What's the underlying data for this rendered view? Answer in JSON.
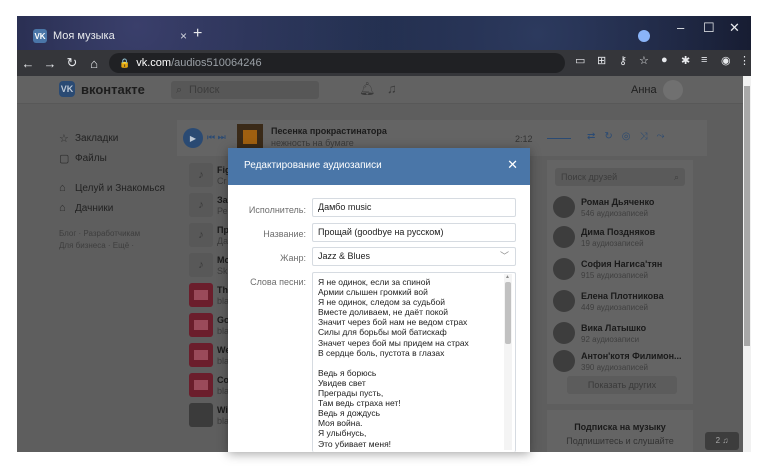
{
  "browser": {
    "tab_title": "Моя музыка",
    "tab_favicon": "VK",
    "close_tab": "×",
    "new_tab": "+",
    "url_host": "vk.com",
    "url_path": "/audios510064246"
  },
  "vk": {
    "logo_text": "вконтакте",
    "search_placeholder": "Поиск",
    "user_name": "Анна"
  },
  "menu": {
    "items": [
      {
        "label": "Закладки"
      },
      {
        "label": "Файлы"
      },
      {
        "label": "Целуй и Знакомься"
      },
      {
        "label": "Дачники"
      }
    ],
    "footer_line1": "Блог · Разработчикам",
    "footer_line2": "Для бизнеса · Ещё ·"
  },
  "player": {
    "track_title": "Песенка прокрастинатора",
    "track_artist": "нежность на бумаге",
    "time": "2:12"
  },
  "tracks": [
    {
      "title": "Fig",
      "artist": "Cr"
    },
    {
      "title": "За",
      "artist": "Ре"
    },
    {
      "title": "Пр",
      "artist": "Да"
    },
    {
      "title": "Мо",
      "artist": "Sk"
    },
    {
      "title": "Th",
      "artist": "bla"
    },
    {
      "title": "Go",
      "artist": "bla"
    },
    {
      "title": "We",
      "artist": "bla"
    },
    {
      "title": "Co",
      "artist": "bla"
    },
    {
      "title": "Wi",
      "artist": "bla"
    }
  ],
  "friends": {
    "search_placeholder": "Поиск друзей",
    "list": [
      {
        "name": "Роман Дьяченко",
        "sub": "546 аудиозаписей"
      },
      {
        "name": "Дима Поздняков",
        "sub": "19 аудиозаписей"
      },
      {
        "name": "София Нагиса'тян",
        "sub": "915 аудиозаписей"
      },
      {
        "name": "Елена Плотникова",
        "sub": "449 аудиозаписей"
      },
      {
        "name": "Вика Латышко",
        "sub": "92 аудиозаписи"
      },
      {
        "name": "Антон'котя Филимон...",
        "sub": "390 аудиозаписей"
      }
    ],
    "show_others": "Показать других"
  },
  "subscribe": {
    "title": "Подписка на музыку",
    "desc": "Подпишитесь и слушайте"
  },
  "counter": "2 ♫",
  "modal": {
    "title": "Редактирование аудиозаписи",
    "close": "✕",
    "artist_label": "Исполнитель:",
    "artist_value": "Дамбо music",
    "title_label": "Название:",
    "title_value": "Прощай (goodbye на русском)",
    "genre_label": "Жанр:",
    "genre_value": "Jazz & Blues",
    "lyrics_label": "Слова песни:",
    "lyrics": [
      "Я не одинок, если за спиной",
      "Армии слышен громкий вой",
      "Я не одинок, следом за судьбой",
      "Вместе доливаем, не даёт покой",
      "Значит через бой нам не ведом страх",
      "Силы для борьбы мой батискаф",
      "Значет через бой мы придем на страх",
      "В сердце боль, пустота в глазах",
      "",
      "Ведь я борюсь",
      "Увидев свет",
      "Преграды пусть,",
      "Там ведь страха нет!",
      "Ведь я дождусь",
      "Моя война.",
      "Я улыбнусь,",
      "Это убивает меня!"
    ]
  }
}
